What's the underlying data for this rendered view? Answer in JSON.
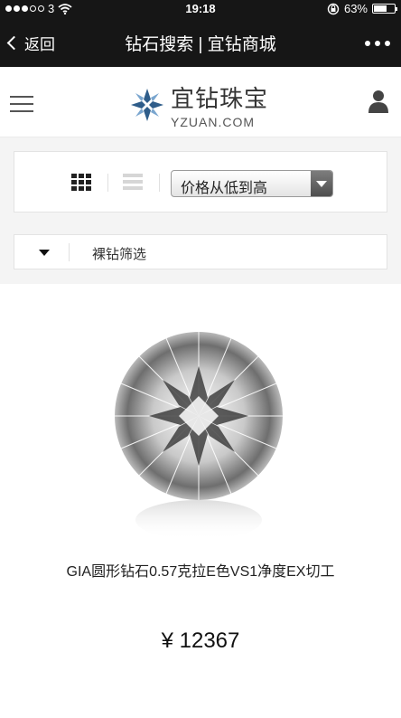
{
  "status_bar": {
    "carrier": "3",
    "time": "19:18",
    "battery": "63%",
    "battery_level": 0.63
  },
  "nav": {
    "back_label": "返回",
    "title": "钻石搜索 | 宜钻商城",
    "more_icon": "more-dots-icon"
  },
  "site_header": {
    "logo_cn": "宜钻珠宝",
    "logo_en": "YZUAN.COM",
    "menu_icon": "hamburger-menu-icon",
    "user_icon": "user-icon"
  },
  "toolbar": {
    "grid_view_icon": "grid-view-icon",
    "list_view_icon": "list-view-icon",
    "sort_selected": "价格从低到高"
  },
  "filter": {
    "label": "裸钻筛选"
  },
  "product": {
    "name": "GIA圆形钻石0.57克拉E色VS1净度EX切工",
    "price": "¥ 12367"
  },
  "colors": {
    "nav_bg": "#161616",
    "page_bg": "#f4f4f4",
    "logo_blue": "#2f5d8a"
  }
}
